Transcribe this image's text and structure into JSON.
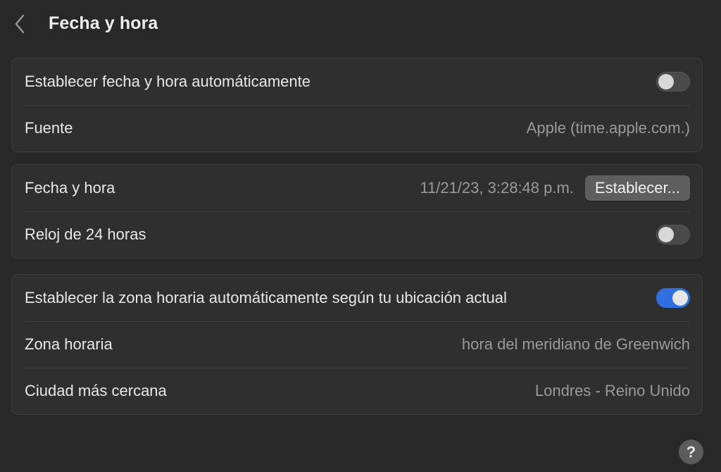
{
  "header": {
    "title": "Fecha y hora",
    "back_icon": "chevron-left-icon"
  },
  "groups": [
    {
      "rows": [
        {
          "label": "Establecer fecha y hora automáticamente",
          "toggle": false
        },
        {
          "label": "Fuente",
          "value": "Apple (time.apple.com.)"
        }
      ]
    },
    {
      "rows": [
        {
          "label": "Fecha y hora",
          "value": "11/21/23, 3:28:48 p.m.",
          "button_label": "Establecer..."
        },
        {
          "label": "Reloj de 24 horas",
          "toggle": false
        }
      ]
    },
    {
      "rows": [
        {
          "label": "Establecer la zona horaria automáticamente según tu ubicación actual",
          "toggle": true
        },
        {
          "label": "Zona horaria",
          "value": "hora del meridiano de Greenwich"
        },
        {
          "label": "Ciudad más cercana",
          "value": "Londres - Reino Unido"
        }
      ]
    }
  ],
  "help": {
    "label": "?",
    "icon": "help-icon"
  },
  "colors": {
    "background": "#282828",
    "group_background": "#2f2f2f",
    "accent": "#2f6fe0",
    "secondary_text": "#9a9a9a"
  }
}
